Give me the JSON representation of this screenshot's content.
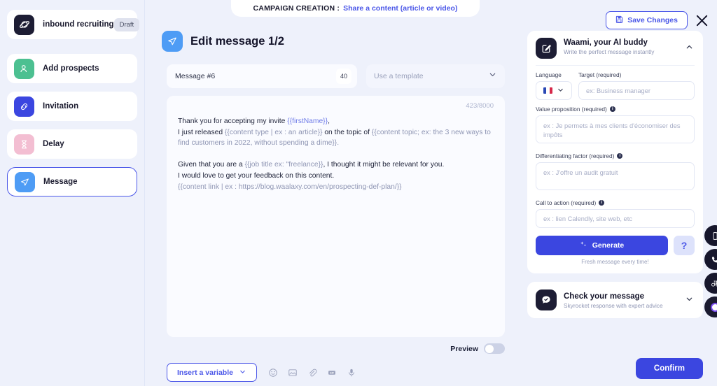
{
  "top": {
    "tab_label": "CAMPAIGN CREATION :",
    "tab_value": "Share a content (article or video)",
    "save_label": "Save Changes",
    "save_icon": "floppy-disk-icon",
    "close_icon": "close-icon"
  },
  "sidebar": {
    "items": [
      {
        "label": "inbound recruiting",
        "icon": "planet-icon",
        "badge": "Draft",
        "icon_bg": "#1d1d34",
        "active": false
      },
      {
        "label": "Add prospects",
        "icon": "user-add-icon",
        "badge": "",
        "icon_bg": "#4cc091",
        "active": false
      },
      {
        "label": "Invitation",
        "icon": "link-icon",
        "badge": "",
        "icon_bg": "#3b46e0",
        "active": false
      },
      {
        "label": "Delay",
        "icon": "hourglass-icon",
        "badge": "",
        "icon_bg": "#f3bed2",
        "active": false
      },
      {
        "label": "Message",
        "icon": "send-icon",
        "badge": "",
        "icon_bg": "#4e9cf5",
        "active": true
      }
    ]
  },
  "main": {
    "title": "Edit message 1/2",
    "title_icon": "send-icon",
    "message_name": "Message #6",
    "message_name_badge": "40",
    "template_placeholder": "Use a template",
    "char_count": "423/8000",
    "body": {
      "l1_a": "Thank you for accepting my invite ",
      "l1_var": "{{firstName}}",
      "l1_b": ",",
      "l2_a": "I just released ",
      "l2_ph1": "{{content type | ex : an article}}",
      "l2_b": " on the topic of ",
      "l2_ph2": "{{content topic; ex: the 3 new ways to find customers in 2022, without spending a dime}}.",
      "l4_a": "Given that you are a ",
      "l4_ph": "{{job title ex: \"freelance}}",
      "l4_b": ", I thought it might be relevant for you.",
      "l5": "I would love to get your feedback on this content.",
      "l6_ph": "{{content link | ex : https://blog.waalaxy.com/en/prospecting-def-plan/}}"
    },
    "preview_label": "Preview",
    "preview_on": false,
    "insert_variable_label": "Insert a variable",
    "tool_icons": [
      "emoji-icon",
      "image-icon",
      "attachment-icon",
      "gif-icon",
      "microphone-icon"
    ]
  },
  "right": {
    "waami": {
      "title": "Waami, your AI buddy",
      "subtitle": "Write the perfect message instantly",
      "icon": "edit-square-icon",
      "collapse_icon": "chevron-up-icon",
      "language_label": "Language",
      "language_value": "french-flag-icon",
      "target_label": "Target (required)",
      "target_placeholder": "ex: Business manager",
      "value_prop_label": "Value proposition (required)",
      "value_prop_placeholder": "ex : Je permets à mes clients d'économiser des impôts",
      "diff_label": "Differentiating factor (required)",
      "diff_placeholder": "ex : J'offre un audit gratuit",
      "cta_label": "Call to action (required)",
      "cta_placeholder": "ex : lien Calendly, site web, etc",
      "generate_label": "Generate",
      "generate_icon": "sparkle-icon",
      "help_label": "?",
      "generate_sub": "Fresh message every time!"
    },
    "check": {
      "title": "Check your message",
      "subtitle": "Skyrocket response with expert advice",
      "icon": "chat-check-icon",
      "expand_icon": "chevron-down-icon"
    },
    "confirm_label": "Confirm"
  },
  "fabs": [
    {
      "icon": "mobile-icon"
    },
    {
      "icon": "phone-icon"
    },
    {
      "icon": "binoculars-icon"
    },
    {
      "icon": "record-icon"
    }
  ],
  "colors": {
    "accent": "#3b46e0",
    "link": "#4b57e8",
    "bg": "#eef1fb",
    "dark": "#1d1d34"
  }
}
